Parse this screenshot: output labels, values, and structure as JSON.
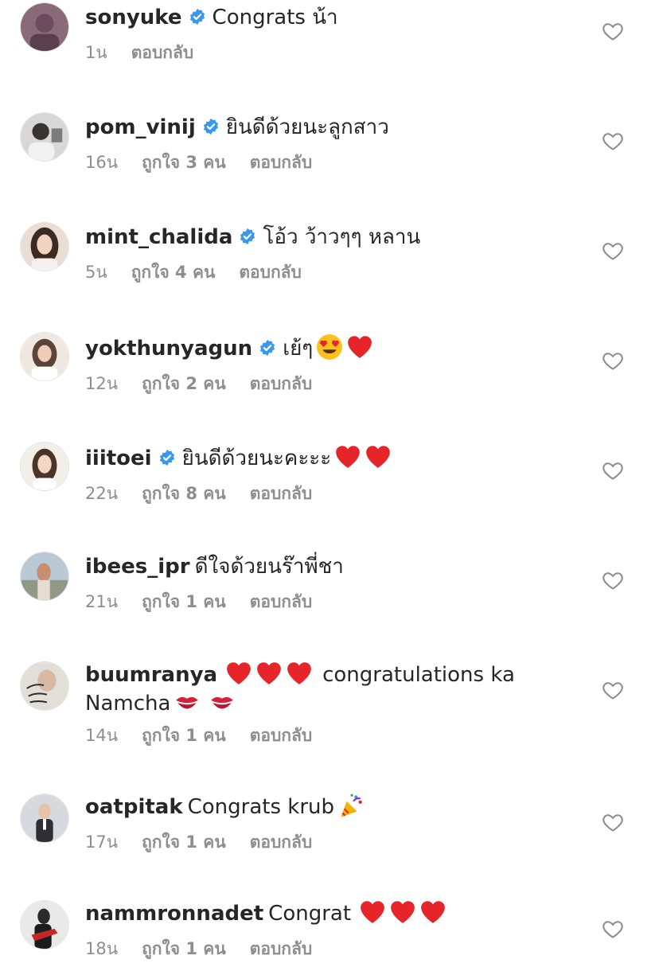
{
  "comments": [
    {
      "username": "sonyuke",
      "verified": true,
      "text": "Congrats น้า",
      "emojis": [],
      "time": "1น",
      "likes": "",
      "reply": "ตอบกลับ",
      "avatar_color": "#6b4b5c"
    },
    {
      "username": "pom_vinij",
      "verified": true,
      "text": "ยินดีด้วยนะลูกสาว",
      "emojis": [],
      "time": "16น",
      "likes": "ถูกใจ 3 คน",
      "reply": "ตอบกลับ",
      "avatar_color": "#9aa0a4"
    },
    {
      "username": "mint_chalida",
      "verified": true,
      "text": "โอ้ว ว้าวๆๆ หลาน",
      "emojis": [],
      "time": "5น",
      "likes": "ถูกใจ 4 คน",
      "reply": "ตอบกลับ",
      "avatar_color": "#4a3a33"
    },
    {
      "username": "yokthunyagun",
      "verified": true,
      "text": "เย้ๆ",
      "emojis": [
        "heart-eyes-emoji",
        "red-heart-emoji"
      ],
      "time": "12น",
      "likes": "ถูกใจ 2 คน",
      "reply": "ตอบกลับ",
      "avatar_color": "#c9b9a8"
    },
    {
      "username": "iiitoei",
      "verified": true,
      "text": "ยินดีด้วยนะคะะะ",
      "emojis": [
        "red-heart-emoji",
        "red-heart-emoji"
      ],
      "time": "22น",
      "likes": "ถูกใจ 8 คน",
      "reply": "ตอบกลับ",
      "avatar_color": "#e8e2dc"
    },
    {
      "username": "ibees_ipr",
      "verified": false,
      "text": "ดีใจด้วยนร๊าพี่ชา",
      "emojis": [],
      "time": "21น",
      "likes": "ถูกใจ 1 คน",
      "reply": "ตอบกลับ",
      "avatar_color": "#9fb3c4"
    },
    {
      "username": "buumranya",
      "verified": false,
      "text": "congratulations ka Namcha",
      "emojis_before": [
        "red-heart-emoji",
        "red-heart-emoji",
        "red-heart-emoji"
      ],
      "emojis": [
        "kiss-mark-emoji",
        "kiss-mark-emoji"
      ],
      "time": "14น",
      "likes": "ถูกใจ 1 คน",
      "reply": "ตอบกลับ",
      "avatar_color": "#d8d4cf"
    },
    {
      "username": "oatpitak",
      "verified": false,
      "text": "Congrats krub",
      "emojis": [
        "party-popper-emoji"
      ],
      "time": "17น",
      "likes": "ถูกใจ 1 คน",
      "reply": "ตอบกลับ",
      "avatar_color": "#c8ccd0"
    },
    {
      "username": "nammronnadet",
      "verified": false,
      "text": "Congrat",
      "emojis": [
        "red-heart-emoji",
        "red-heart-emoji",
        "red-heart-emoji"
      ],
      "time": "18น",
      "likes": "ถูกใจ 1 คน",
      "reply": "ตอบกลับ",
      "avatar_color": "#2a2a2a"
    }
  ],
  "colors": {
    "verified_badge": "#3897f0",
    "meta_text": "#8e8e8e",
    "username": "#262626",
    "heart_outline": "#8e8e8e"
  }
}
